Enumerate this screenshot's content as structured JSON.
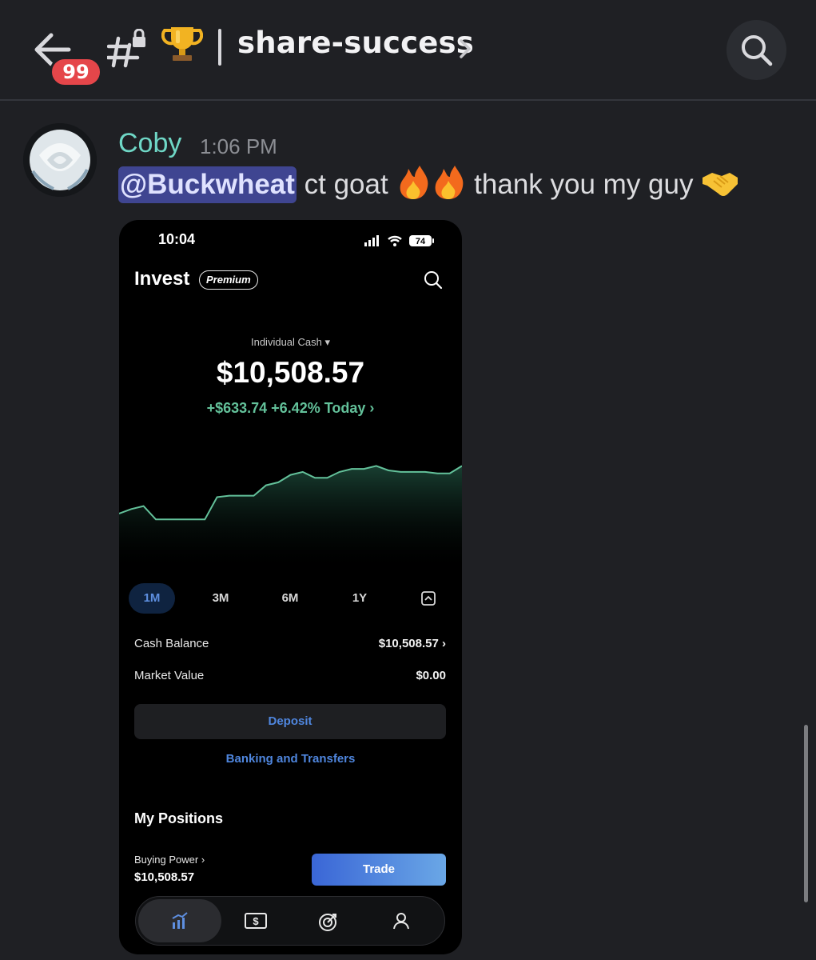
{
  "header": {
    "unread_count": "99",
    "channel_emoji": "🏆",
    "channel_name": "share-success",
    "icons": [
      "back-arrow-icon",
      "locked-channel-hash-icon",
      "chevron-right-icon",
      "search-icon"
    ]
  },
  "message": {
    "author": "Coby",
    "author_color": "#6fd7c6",
    "timestamp": "1:06 PM",
    "mention": "@Buckwheat",
    "text_part1": " ct goat ",
    "fire_emoji": "🔥🔥",
    "text_part2": " thank you my guy ",
    "handshake_emoji": "🤝"
  },
  "attachment": {
    "status_time": "10:04",
    "battery": "74",
    "title": "Invest",
    "badge": "Premium",
    "account_selector": "Individual Cash ▾",
    "balance": "$10,508.57",
    "change": "+$633.74 +6.42% Today ›",
    "chart_color": "#63c19a",
    "chart_data": {
      "type": "area",
      "title": "",
      "range": "1M",
      "values": [
        34,
        37,
        39,
        30,
        30,
        30,
        30,
        30,
        45,
        46,
        46,
        46,
        53,
        55,
        60,
        62,
        58,
        58,
        62,
        64,
        64,
        66,
        63,
        62,
        62,
        62,
        61,
        61,
        66
      ]
    },
    "ranges": [
      "1M",
      "3M",
      "6M",
      "1Y"
    ],
    "active_range": "1M",
    "rows": [
      {
        "label": "Cash Balance",
        "value": "$10,508.57 ›"
      },
      {
        "label": "Market Value",
        "value": "$0.00"
      }
    ],
    "deposit_label": "Deposit",
    "banking_link": "Banking and Transfers",
    "positions_title": "My Positions",
    "buying_power_label": "Buying Power ›",
    "buying_power_value": "$10,508.57",
    "trade_label": "Trade",
    "accent": "#4f86de",
    "tabs": [
      "chart-icon",
      "cash-icon",
      "target-icon",
      "profile-icon"
    ]
  }
}
